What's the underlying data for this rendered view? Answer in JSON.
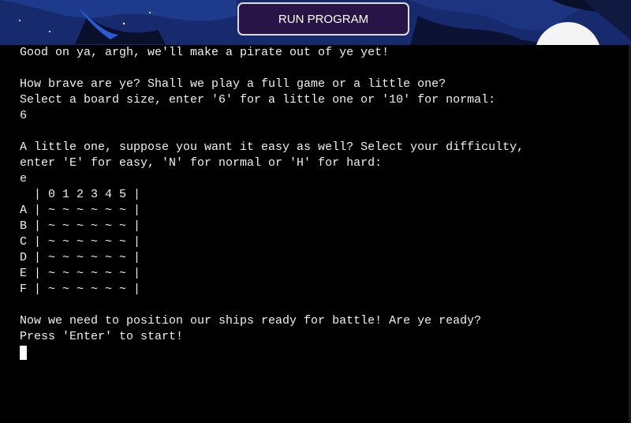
{
  "toolbar": {
    "run_label": "RUN PROGRAM"
  },
  "terminal": {
    "lines": [
      "Good on ya, argh, we'll make a pirate out of ye yet!",
      "",
      "How brave are ye? Shall we play a full game or a little one?",
      "Select a board size, enter '6' for a little one or '10' for normal:",
      "6",
      "",
      "A little one, suppose you want it easy as well? Select your difficulty,",
      "enter 'E' for easy, 'N' for normal or 'H' for hard:",
      "e",
      "  | 0 1 2 3 4 5 |",
      "A | ~ ~ ~ ~ ~ ~ |",
      "B | ~ ~ ~ ~ ~ ~ |",
      "C | ~ ~ ~ ~ ~ ~ |",
      "D | ~ ~ ~ ~ ~ ~ |",
      "E | ~ ~ ~ ~ ~ ~ |",
      "F | ~ ~ ~ ~ ~ ~ |",
      "",
      "Now we need to position our ships ready for battle! Are ye ready?",
      "Press 'Enter' to start!"
    ]
  },
  "colors": {
    "sky": "#16205a",
    "button_bg": "#281446",
    "terminal_bg": "#000000",
    "terminal_text": "#f0f0f0"
  }
}
